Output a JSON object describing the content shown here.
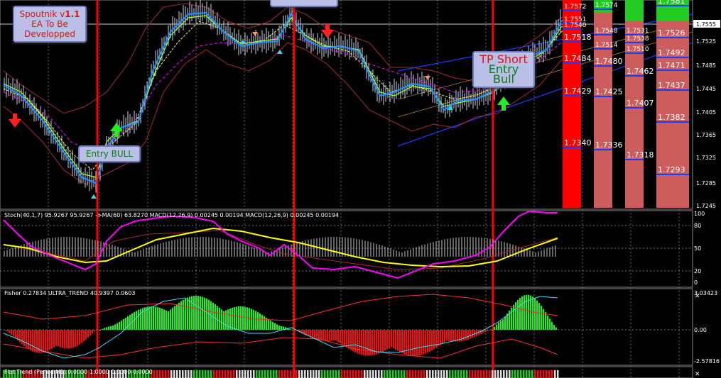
{
  "colors": {
    "background": "#000000",
    "grid": "#5a5a5a",
    "price_line": "#1e90ff",
    "ma_fast": "#aaff33",
    "ma_slow": "#ff00ff",
    "bollinger": "#a52a2a",
    "candle": "#d0d8e8",
    "channel": "#1a3cff",
    "vline": "#ff0000",
    "stoch_main": "#ff00ff",
    "stoch_signal": "#ffff00",
    "fisher_up": "#22ee22",
    "fisher_down": "#ee1111",
    "level_box_red": "#ff0000",
    "level_box_pink": "#cd5c5c",
    "level_box_green": "#22cc22"
  },
  "callouts": {
    "spoutnik": {
      "line1_a": "Spoutnik v",
      "line1_b": "1.1",
      "line2": "EA To Be",
      "line3": "Developped"
    },
    "entry_bull": {
      "text": "Entry BULL"
    },
    "tp_short": {
      "line1": "TP Short",
      "line2": "Entry Bull"
    }
  },
  "main_chart": {
    "price_axis": [
      "1.7555",
      "1.7525",
      "1.7485",
      "1.7445",
      "1.7405",
      "1.7365",
      "1.7325",
      "1.7285",
      "1.7245"
    ],
    "current_price": "1.7555",
    "level_columns": [
      {
        "color": "red",
        "labels": [
          "1.7572",
          "1.7551",
          "1.7540",
          "1.7518",
          "1.7484",
          "1.7429",
          "1.7340"
        ]
      },
      {
        "color": "pink",
        "labels": [
          "1.7574",
          "1.7548",
          "1.7514",
          "1.7480",
          "1.7425",
          "1.7336"
        ]
      },
      {
        "color": "pink",
        "labels": [
          "1.7531",
          "1.7538",
          "1.7510",
          "1.7462",
          "1.7407",
          "1.7318"
        ]
      },
      {
        "color": "pink",
        "labels": [
          "1.7581",
          "1.7526",
          "1.7492",
          "1.7471",
          "1.7437",
          "1.7382",
          "1.7293"
        ]
      }
    ]
  },
  "stoch_panel": {
    "header": "Stoch(40,1,7) 95.9267 95.9267 ->MA(60) 63.8270  MACD(12,26,9) 0.00245 0.00194  MACD(12,26,9) 0.00245 0.00194",
    "axis": [
      "100",
      "80",
      "50",
      "20",
      "0"
    ]
  },
  "fisher_panel": {
    "header": "Fisher 0.27834  ULTRA_TREND 40.9397 0.0603",
    "axis": [
      "3.03423",
      "0.00",
      "-2.57816"
    ]
  },
  "flat_panel": {
    "header": "Flat Trend (Period  H1) 0.0000 1.0000 0.0000 0.0000"
  }
}
